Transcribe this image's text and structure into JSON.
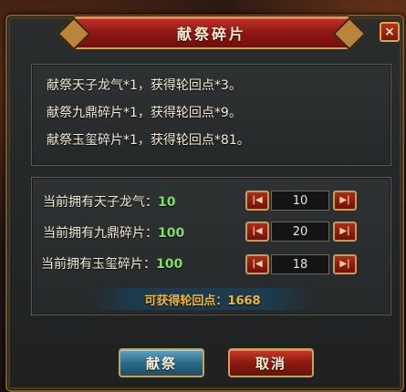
{
  "dialog": {
    "title": "献祭碎片",
    "close_symbol": "×"
  },
  "descriptions": [
    "献祭天子龙气*1，获得轮回点*3。",
    "献祭九鼎碎片*1，获得轮回点*9。",
    "献祭玉玺碎片*1，获得轮回点*81。"
  ],
  "rows": [
    {
      "label": "当前拥有天子龙气：",
      "owned": "10",
      "input_value": "10"
    },
    {
      "label": "当前拥有九鼎碎片：",
      "owned": "100",
      "input_value": "20"
    },
    {
      "label": "当前拥有玉玺碎片：",
      "owned": "100",
      "input_value": "18"
    }
  ],
  "reward": {
    "text": "可获得轮回点：1668"
  },
  "buttons": {
    "confirm_label": "献祭",
    "cancel_label": "取消"
  },
  "icons": {
    "decrease": "step-first-icon",
    "increase": "step-last-icon",
    "close": "close-icon"
  },
  "colors": {
    "owned_count": "#7fe06a",
    "reward_text": "#f2b63a",
    "title_bar": "#8e1612",
    "confirm_button": "#2a6b8a",
    "cancel_button": "#8c1a10"
  }
}
